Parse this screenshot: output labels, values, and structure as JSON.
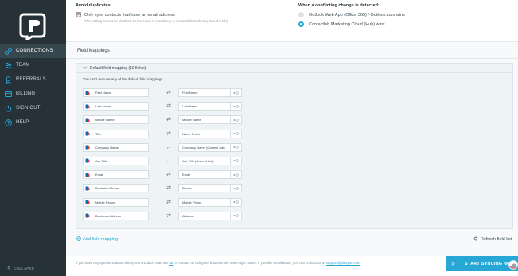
{
  "sidebar": {
    "items": [
      {
        "label": "CONNECTIONS",
        "icon": "connections-icon",
        "active": true
      },
      {
        "label": "TEAM",
        "icon": "team-icon",
        "active": false
      },
      {
        "label": "REFERRALS",
        "icon": "referrals-icon",
        "active": false
      },
      {
        "label": "BILLING",
        "icon": "billing-icon",
        "active": false
      },
      {
        "label": "SIGN OUT",
        "icon": "power-icon",
        "active": false
      },
      {
        "label": "HELP",
        "icon": "help-icon",
        "active": false
      }
    ],
    "collapse_label": "COLLAPSE"
  },
  "duplicates": {
    "title": "Avoid duplicates",
    "checkbox_label": "Only sync contacts that have an email address",
    "checked": true,
    "note": "This setting cannot be disabled as the email is mandatory in Contactlab Marketing Cloud (Hub)."
  },
  "conflict": {
    "title": "When a conflicting change is detected:",
    "options": [
      {
        "label": "Outlook Web App (Office 365) / Outlook.com wins",
        "selected": false
      },
      {
        "label": "Contactlab Marketing Cloud (Hub) wins",
        "selected": true
      }
    ]
  },
  "field_mappings": {
    "title": "Field Mappings",
    "panel_header": "Default field mapping (10 fields)",
    "note": "You can't remove any of the default field mappings.",
    "rows": [
      {
        "left": "First Name",
        "direction": "both",
        "right": "First Name"
      },
      {
        "left": "Last Name",
        "direction": "both",
        "right": "Last Name"
      },
      {
        "left": "Middle Name",
        "direction": "both",
        "right": "Middle Name"
      },
      {
        "left": "Title",
        "direction": "both",
        "right": "Name Prefix"
      },
      {
        "left": "Company Name",
        "direction": "left",
        "right": "Company Name (Current Job)"
      },
      {
        "left": "Job Title",
        "direction": "left",
        "right": "Job Title (Current Job)"
      },
      {
        "left": "Email",
        "direction": "both",
        "right": "Email"
      },
      {
        "left": "Business Phone",
        "direction": "both",
        "right": "Phone"
      },
      {
        "left": "Mobile Phone",
        "direction": "both",
        "right": "Mobile Phone"
      },
      {
        "left": "Business Address",
        "direction": "both",
        "right": "Address"
      }
    ],
    "arrows": {
      "both": "⇄",
      "left": "←"
    },
    "add_label": "Add field mapping",
    "refresh_label": "Refresh field list"
  },
  "footer": {
    "text_before": "If you have any questions about the synchronization read our ",
    "faq_link": "faq",
    "text_middle": " or contact us using the button in the lower right corner. If you like email better, you can contact us at ",
    "email_link": "support@piesync.com",
    "text_after": "."
  },
  "start_button": {
    "label": "START SYNCING NOW!"
  },
  "colors": {
    "sidebar_bg": "#263238",
    "accent": "#26a7d6",
    "panel_bg": "#eef3f6",
    "source_icon": "#1565c0",
    "source_icon_accent": "#e53935"
  }
}
